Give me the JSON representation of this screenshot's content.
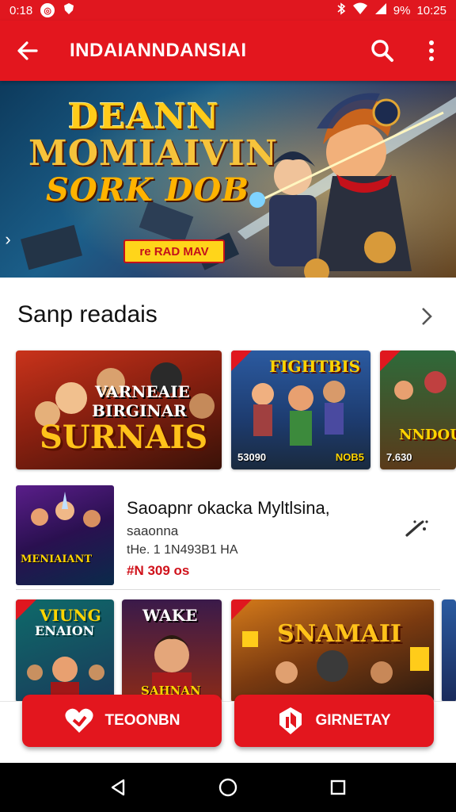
{
  "status_bar": {
    "time_left": "0:18",
    "battery": "9%",
    "time_right": "10:25"
  },
  "app_bar": {
    "title": "INDAIANNDANSIAI",
    "back_icon": "arrow-left-icon",
    "search_icon": "search-icon",
    "menu_icon": "more-vertical-icon"
  },
  "banner": {
    "line1": "DEANN",
    "line2": "MOMIAIVIN",
    "line3": "SORK DOB",
    "cta": "re RAD MAV"
  },
  "section": {
    "title": "Sanp readais",
    "more_icon": "chevron-right-icon"
  },
  "cards": [
    {
      "title_top": "VARNEAIE",
      "title_mid": "BIRGINAR",
      "title_main": "SURNAIS",
      "meta": "",
      "price": ""
    },
    {
      "title_top": "FIGHTBIS",
      "meta": "53090",
      "price": "NOB5"
    },
    {
      "title_top": "NNDOU",
      "meta": "7.630",
      "price": ""
    }
  ],
  "list_item": {
    "thumb_title": "MENIAIANT",
    "title": "Saoapnr okacka Myltlsina,",
    "subtitle": "saaonna",
    "meta": "tHe. 1 1N493B1 HA",
    "price": "#N 309 os",
    "action_icon": "wand-icon"
  },
  "bottom_cards": [
    {
      "title": "VIUNG",
      "subtitle": "ENAION"
    },
    {
      "title": "WAKE",
      "subtitle": "SAHNAN"
    },
    {
      "title": "SNAMAII"
    }
  ],
  "buttons": {
    "primary": "TEOONBN",
    "secondary": "GIRNETAY",
    "primary_icon": "heart-icon",
    "secondary_icon": "shield-icon"
  },
  "colors": {
    "brand_red": "#e3161e",
    "price_red": "#d0121b",
    "banner_gold": "#ffcc1a"
  }
}
